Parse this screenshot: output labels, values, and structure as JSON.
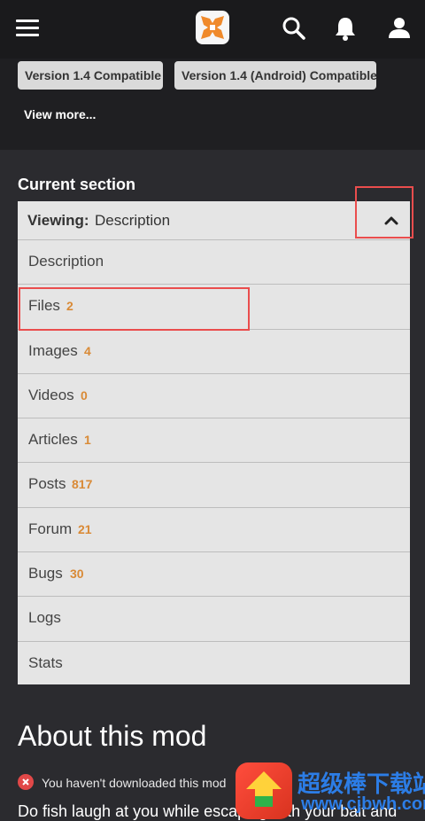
{
  "header": {
    "icons": [
      "hamburger-menu-icon",
      "site-logo",
      "search-icon",
      "bell-icon",
      "user-icon"
    ]
  },
  "compat_tags": [
    "Version 1.4 Compatible",
    "Version 1.4 (Android) Compatible"
  ],
  "view_more_label": "View more...",
  "current_section": {
    "title": "Current section",
    "viewing_label": "Viewing:",
    "viewing_value": "Description"
  },
  "menu_items": [
    {
      "label": "Description",
      "count": ""
    },
    {
      "label": "Files",
      "count": "2"
    },
    {
      "label": "Images",
      "count": "4"
    },
    {
      "label": "Videos",
      "count": "0"
    },
    {
      "label": "Articles",
      "count": "1"
    },
    {
      "label": "Posts",
      "count": "817"
    },
    {
      "label": "Forum",
      "count": "21"
    },
    {
      "label": "Bugs",
      "count": "30"
    },
    {
      "label": "Logs",
      "count": ""
    },
    {
      "label": "Stats",
      "count": ""
    }
  ],
  "about": {
    "title": "About this mod",
    "notice": "You haven't downloaded this mod",
    "description": "Do fish laugh at you while escaping with your bait and"
  },
  "watermark": {
    "cn": "超级棒下载站",
    "url": "www.cjbwh.com"
  },
  "colors": {
    "count_accent": "#d98a36",
    "highlight": "#ea4d4d",
    "page_bg": "#2b2b2f"
  }
}
